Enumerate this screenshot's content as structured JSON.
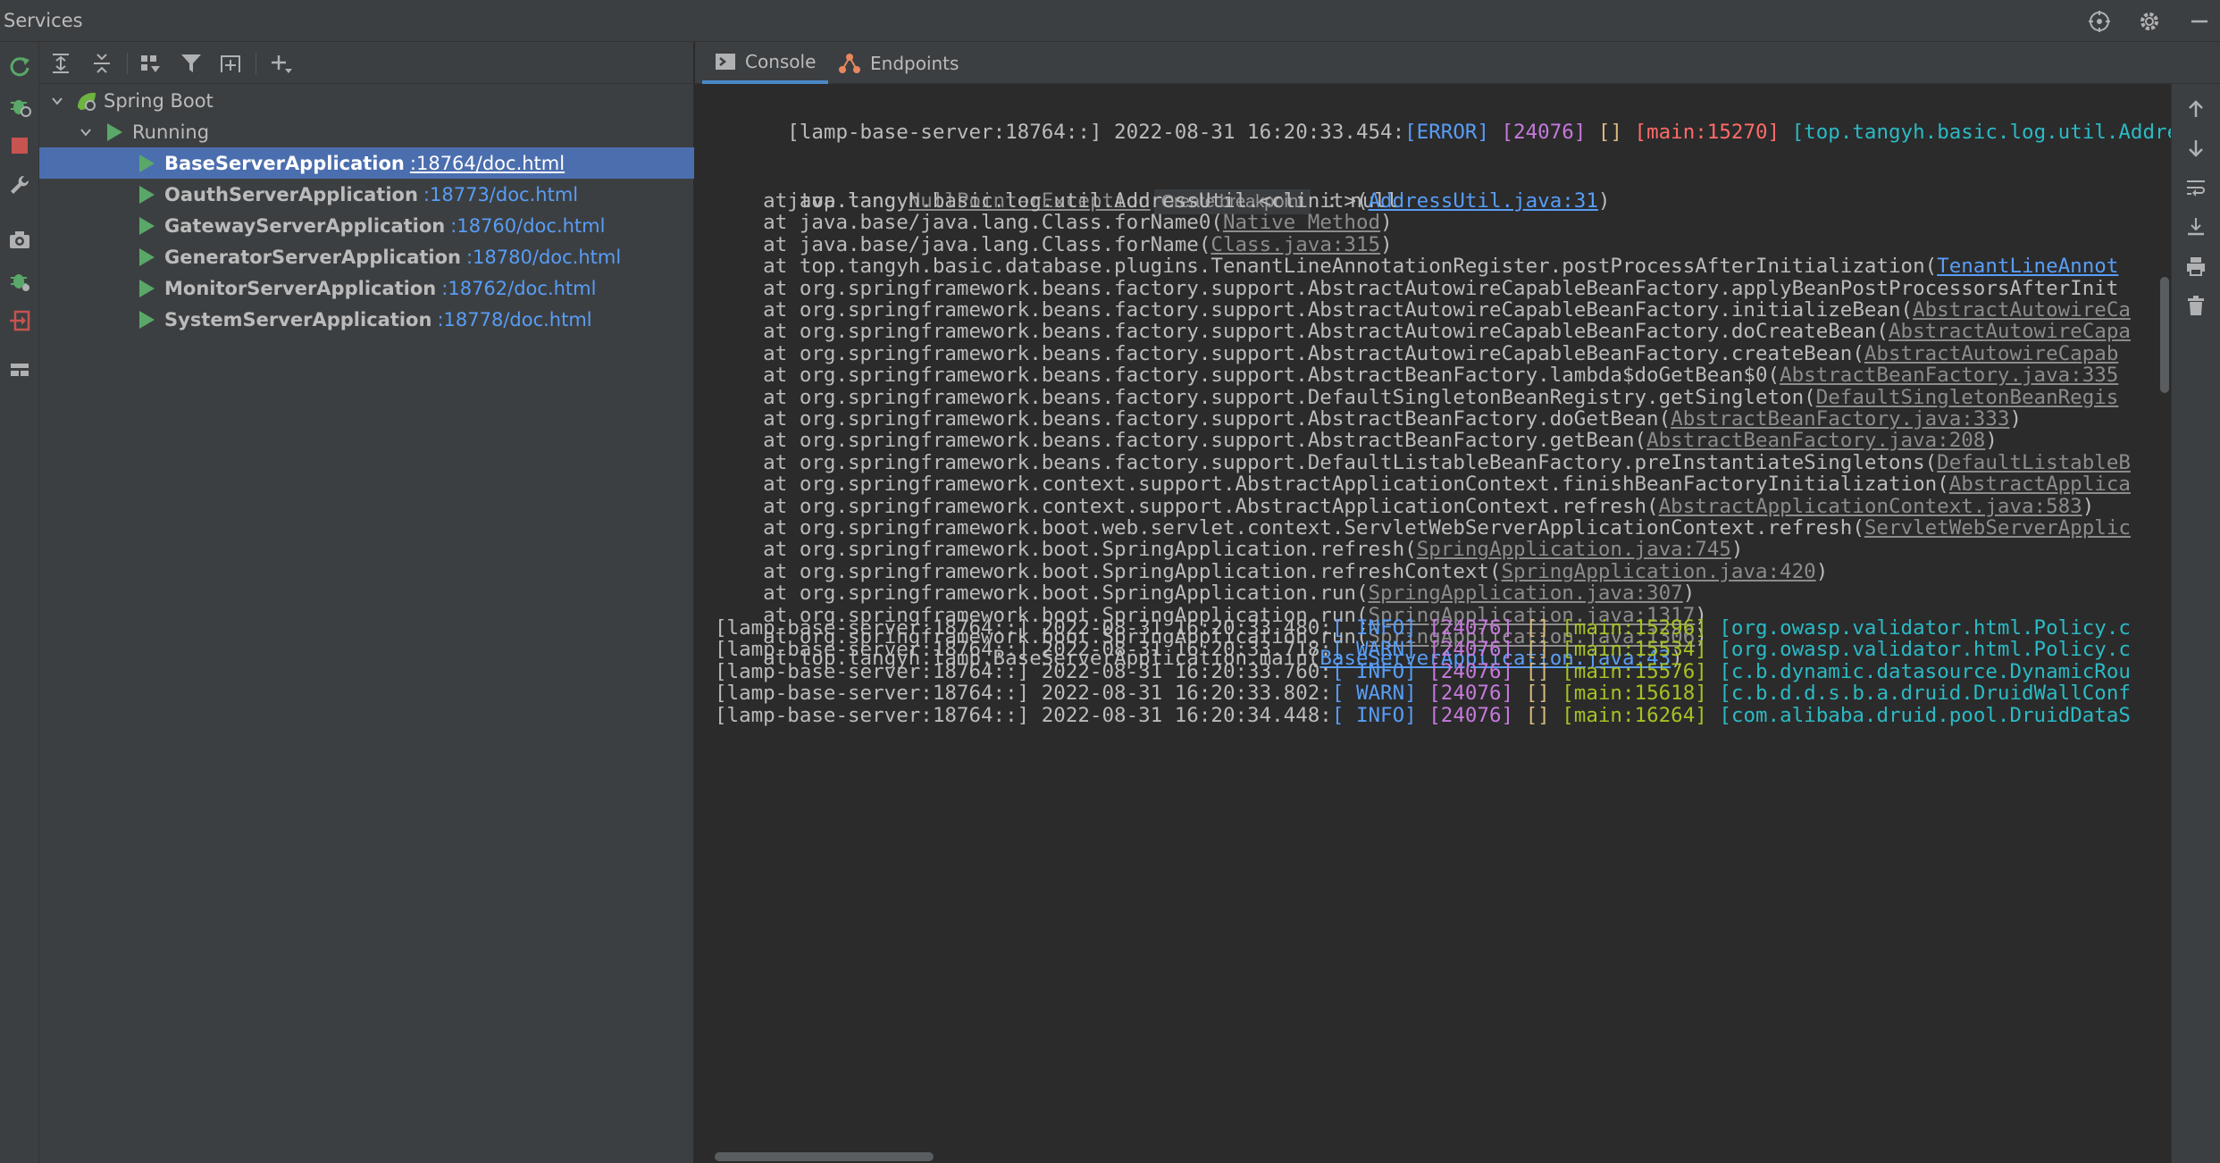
{
  "window": {
    "title": "Services",
    "right_icons": [
      "crosshair-icon",
      "gear-icon",
      "minimize-icon"
    ]
  },
  "colors": {
    "selection": "#4b6eaf",
    "link": "#589df6",
    "run_green": "#59a869",
    "error_red": "#ff6b68"
  },
  "left_strip_icons": [
    "rerun-icon",
    "debug-icon",
    "stop-icon",
    "wrench-icon",
    "camera-icon",
    "debug-bug-icon",
    "exit-icon",
    "layout-icon"
  ],
  "tree_toolbar_icons": [
    "expand-all-icon",
    "collapse-all-icon",
    "group-icon",
    "filter-icon",
    "new-tab-icon",
    "add-icon"
  ],
  "tree": {
    "root": "Spring Boot",
    "group": "Running",
    "items": [
      {
        "name": "BaseServerApplication",
        "link": ":18764/doc.html"
      },
      {
        "name": "OauthServerApplication",
        "link": ":18773/doc.html"
      },
      {
        "name": "GatewayServerApplication",
        "link": ":18760/doc.html"
      },
      {
        "name": "GeneratorServerApplication",
        "link": ":18780/doc.html"
      },
      {
        "name": "MonitorServerApplication",
        "link": ":18762/doc.html"
      },
      {
        "name": "SystemServerApplication",
        "link": ":18778/doc.html"
      }
    ]
  },
  "tabs": [
    {
      "label": "Console",
      "icon": "console-icon"
    },
    {
      "label": "Endpoints",
      "icon": "endpoints-icon"
    }
  ],
  "console": {
    "error_header": {
      "prefix": "[lamp-base-server:18764::] 2022-08-31 16:20:33.454:",
      "level": "[ERROR]",
      "pid": "[24076]",
      "ctx": "[]",
      "thread": "[main:15270]",
      "logger": "[top.tangyh.basic.log.util.Addres"
    },
    "exception": {
      "prefix": "java.lang.",
      "class": "NullPointerException",
      "hint": "Create breakpoint",
      "suffix": " : null"
    },
    "stack": [
      {
        "text": "    at top.tangyh.basic.log.util.AddressUtil.<clinit>(",
        "link": "AddressUtil.java:31",
        "end": ")",
        "blue": true
      },
      {
        "text": "    at java.base/java.lang.Class.forName0(",
        "link": "Native Method",
        "end": ")",
        "blue": false
      },
      {
        "text": "    at java.base/java.lang.Class.forName(",
        "link": "Class.java:315",
        "end": ")",
        "blue": false
      },
      {
        "text": "    at top.tangyh.basic.database.plugins.TenantLineAnnotationRegister.postProcessAfterInitialization(",
        "link": "TenantLineAnnot",
        "end": "",
        "blue": true
      },
      {
        "text": "    at org.springframework.beans.factory.support.AbstractAutowireCapableBeanFactory.applyBeanPostProcessorsAfterInit",
        "link": "",
        "end": "",
        "blue": false
      },
      {
        "text": "    at org.springframework.beans.factory.support.AbstractAutowireCapableBeanFactory.initializeBean(",
        "link": "AbstractAutowireCa",
        "end": "",
        "blue": false
      },
      {
        "text": "    at org.springframework.beans.factory.support.AbstractAutowireCapableBeanFactory.doCreateBean(",
        "link": "AbstractAutowireCapa",
        "end": "",
        "blue": false
      },
      {
        "text": "    at org.springframework.beans.factory.support.AbstractAutowireCapableBeanFactory.createBean(",
        "link": "AbstractAutowireCapab",
        "end": "",
        "blue": false
      },
      {
        "text": "    at org.springframework.beans.factory.support.AbstractBeanFactory.lambda$doGetBean$0(",
        "link": "AbstractBeanFactory.java:335",
        "end": "",
        "blue": false
      },
      {
        "text": "    at org.springframework.beans.factory.support.DefaultSingletonBeanRegistry.getSingleton(",
        "link": "DefaultSingletonBeanRegis",
        "end": "",
        "blue": false
      },
      {
        "text": "    at org.springframework.beans.factory.support.AbstractBeanFactory.doGetBean(",
        "link": "AbstractBeanFactory.java:333",
        "end": ")",
        "blue": false
      },
      {
        "text": "    at org.springframework.beans.factory.support.AbstractBeanFactory.getBean(",
        "link": "AbstractBeanFactory.java:208",
        "end": ")",
        "blue": false
      },
      {
        "text": "    at org.springframework.beans.factory.support.DefaultListableBeanFactory.preInstantiateSingletons(",
        "link": "DefaultListableB",
        "end": "",
        "blue": false
      },
      {
        "text": "    at org.springframework.context.support.AbstractApplicationContext.finishBeanFactoryInitialization(",
        "link": "AbstractApplica",
        "end": "",
        "blue": false
      },
      {
        "text": "    at org.springframework.context.support.AbstractApplicationContext.refresh(",
        "link": "AbstractApplicationContext.java:583",
        "end": ")",
        "blue": false
      },
      {
        "text": "    at org.springframework.boot.web.servlet.context.ServletWebServerApplicationContext.refresh(",
        "link": "ServletWebServerApplic",
        "end": "",
        "blue": false
      },
      {
        "text": "    at org.springframework.boot.SpringApplication.refresh(",
        "link": "SpringApplication.java:745",
        "end": ")",
        "blue": false
      },
      {
        "text": "    at org.springframework.boot.SpringApplication.refreshContext(",
        "link": "SpringApplication.java:420",
        "end": ")",
        "blue": false
      },
      {
        "text": "    at org.springframework.boot.SpringApplication.run(",
        "link": "SpringApplication.java:307",
        "end": ")",
        "blue": false
      },
      {
        "text": "    at org.springframework.boot.SpringApplication.run(",
        "link": "SpringApplication.java:1317",
        "end": ")",
        "blue": false
      },
      {
        "text": "    at org.springframework.boot.SpringApplication.run(",
        "link": "SpringApplication.java:1306",
        "end": ")",
        "blue": false
      },
      {
        "text": "    at top.tangyh.lamp.BaseServerApplication.main(",
        "link": "BaseServerApplication.java:43",
        "end": ")",
        "blue": true
      }
    ],
    "logs": [
      {
        "prefix": "[lamp-base-server:18764::] 2022-08-31 16:20:33.480:",
        "level": "[ INFO]",
        "pid": "[24076]",
        "ctx": "[]",
        "thread": "[main:15296]",
        "logger": "[org.owasp.validator.html.Policy.c"
      },
      {
        "prefix": "[lamp-base-server:18764::] 2022-08-31 16:20:33.718:",
        "level": "[ WARN]",
        "pid": "[24076]",
        "ctx": "[]",
        "thread": "[main:15534]",
        "logger": "[org.owasp.validator.html.Policy.c"
      },
      {
        "prefix": "[lamp-base-server:18764::] 2022-08-31 16:20:33.760:",
        "level": "[ INFO]",
        "pid": "[24076]",
        "ctx": "[]",
        "thread": "[main:15576]",
        "logger": "[c.b.dynamic.datasource.DynamicRou"
      },
      {
        "prefix": "[lamp-base-server:18764::] 2022-08-31 16:20:33.802:",
        "level": "[ WARN]",
        "pid": "[24076]",
        "ctx": "[]",
        "thread": "[main:15618]",
        "logger": "[c.b.d.d.s.b.a.druid.DruidWallConf"
      },
      {
        "prefix": "[lamp-base-server:18764::] 2022-08-31 16:20:34.448:",
        "level": "[ INFO]",
        "pid": "[24076]",
        "ctx": "[]",
        "thread": "[main:16264]",
        "logger": "[com.alibaba.druid.pool.DruidDataS"
      }
    ]
  },
  "right_strip_icons": [
    "up-arrow-icon",
    "down-arrow-icon",
    "soft-wrap-icon",
    "scroll-to-end-icon",
    "print-icon",
    "trash-icon"
  ]
}
